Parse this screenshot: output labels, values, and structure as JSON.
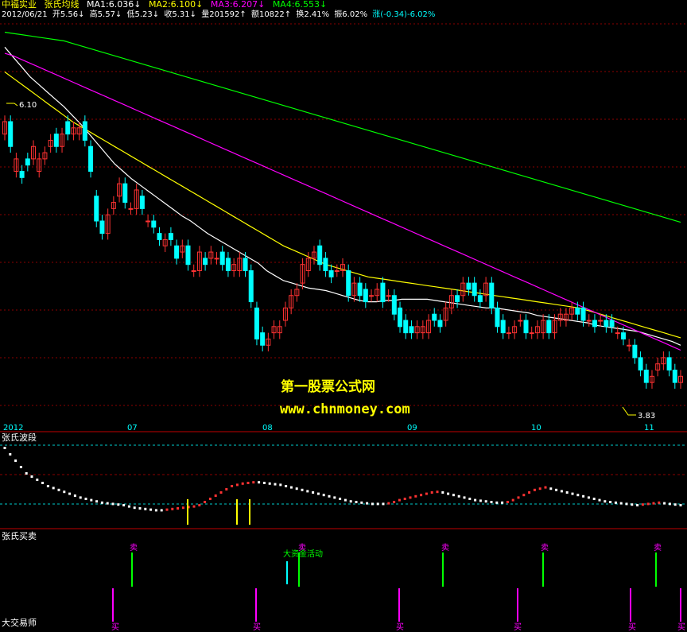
{
  "header": {
    "stock_name": "中福实业",
    "indicator_name": "张氏均线",
    "ma1": "MA1:6.036↓",
    "ma2": "MA2:6.100↓",
    "ma3": "MA3:6.207↓",
    "ma4": "MA4:6.553↓"
  },
  "info_bar": {
    "date": "2012/06/21",
    "open": "开5.56↓",
    "high": "高5.57↓",
    "low": "低5.23↓",
    "close": "收5.31↓",
    "volume": "量201592↑",
    "amount": "额10822↑",
    "turnover": "换2.41%",
    "amplitude": "振6.02%",
    "change": "涨(-0.34)-6.02%"
  },
  "price_labels": {
    "high_mark": "6.10",
    "low_mark": "3.83"
  },
  "watermark": {
    "line1": "第一股票公式网",
    "line2": "www.chnmoney.com"
  },
  "x_axis": {
    "labels": [
      "2012",
      "07",
      "08",
      "09",
      "10",
      "11"
    ]
  },
  "panel2": {
    "title": "张氏波段"
  },
  "panel3": {
    "title": "张氏买卖",
    "corner_label": "大交易师",
    "sell_label": "卖",
    "buy_label": "买",
    "big_money_label": "大资金活动"
  },
  "colors": {
    "up": "#ff3232",
    "down": "#00ffff",
    "ma1": "#ffffff",
    "ma2": "#ffff00",
    "ma3": "#ff00ff",
    "ma4": "#00ff00",
    "grid": "#8b0000",
    "sell_bar": "#00ff00",
    "buy_bar": "#ff00ff"
  },
  "chart_data": [
    {
      "type": "candlestick",
      "title": "张氏均线",
      "ylim": [
        3.6,
        6.8
      ],
      "x": [
        0,
        1,
        2,
        3,
        4,
        5,
        6,
        7,
        8,
        9,
        10,
        11,
        12,
        13,
        14,
        15,
        16,
        17,
        18,
        19,
        20,
        21,
        22,
        23,
        24,
        25,
        26,
        27,
        28,
        29,
        30,
        31,
        32,
        33,
        34,
        35,
        36,
        37,
        38,
        39,
        40,
        41,
        42,
        43,
        44,
        45,
        46,
        47,
        48,
        49,
        50,
        51,
        52,
        53,
        54,
        55,
        56,
        57,
        58,
        59,
        60,
        61,
        62,
        63,
        64,
        65,
        66,
        67,
        68,
        69,
        70,
        71,
        72,
        73,
        74,
        75,
        76,
        77,
        78,
        79,
        80,
        81,
        82,
        83,
        84,
        85,
        86,
        87,
        88,
        89,
        90,
        91,
        92,
        93,
        94,
        95,
        96,
        97,
        98,
        99,
        100,
        101,
        102,
        103,
        104,
        105,
        106,
        107,
        108,
        109,
        110,
        111,
        112,
        113,
        114,
        115,
        116,
        117,
        118,
        119,
        120,
        121,
        122,
        123,
        124,
        125,
        126,
        127,
        128,
        129,
        130,
        131,
        132,
        133,
        134,
        135,
        136,
        137,
        138,
        139
      ],
      "open": [
        5.9,
        6.0,
        5.6,
        5.6,
        5.7,
        5.7,
        5.6,
        5.7,
        5.8,
        5.9,
        5.8,
        6.0,
        5.9,
        5.9,
        6.0,
        5.8,
        5.4,
        5.2,
        5.1,
        5.3,
        5.4,
        5.5,
        5.3,
        5.3,
        5.4,
        5.2,
        5.2,
        5.1,
        5.0,
        5.1,
        5.0,
        4.95,
        5.0,
        4.8,
        4.8,
        4.9,
        4.9,
        4.9,
        4.95,
        4.9,
        4.8,
        4.8,
        4.9,
        4.8,
        4.5,
        4.3,
        4.2,
        4.3,
        4.3,
        4.4,
        4.5,
        4.6,
        4.7,
        4.8,
        4.9,
        5.0,
        4.9,
        4.8,
        4.8,
        4.8,
        4.8,
        4.6,
        4.7,
        4.65,
        4.6,
        4.6,
        4.7,
        4.6,
        4.6,
        4.5,
        4.4,
        4.35,
        4.3,
        4.3,
        4.3,
        4.45,
        4.4,
        4.4,
        4.5,
        4.6,
        4.6,
        4.7,
        4.7,
        4.6,
        4.6,
        4.7,
        4.5,
        4.4,
        4.3,
        4.3,
        4.4,
        4.4,
        4.3,
        4.3,
        4.3,
        4.4,
        4.3,
        4.4,
        4.4,
        4.45,
        4.5,
        4.5,
        4.4,
        4.4,
        4.4,
        4.4,
        4.4,
        4.3,
        4.3,
        4.2,
        4.2,
        4.1,
        4.0,
        3.9,
        4.0,
        4.05,
        4.1,
        4.0,
        3.9
      ],
      "close": [
        6.0,
        5.8,
        5.7,
        5.55,
        5.65,
        5.8,
        5.7,
        5.75,
        5.85,
        5.8,
        5.9,
        5.9,
        5.95,
        5.95,
        5.85,
        5.6,
        5.2,
        5.1,
        5.25,
        5.35,
        5.5,
        5.35,
        5.3,
        5.45,
        5.3,
        5.2,
        5.15,
        5.05,
        5.05,
        5.05,
        4.9,
        5.0,
        4.85,
        4.8,
        4.95,
        4.85,
        4.95,
        4.9,
        4.85,
        4.8,
        4.85,
        4.9,
        4.8,
        4.55,
        4.25,
        4.2,
        4.25,
        4.35,
        4.35,
        4.5,
        4.6,
        4.65,
        4.85,
        4.9,
        4.95,
        4.85,
        4.8,
        4.75,
        4.8,
        4.85,
        4.6,
        4.7,
        4.6,
        4.55,
        4.6,
        4.65,
        4.55,
        4.6,
        4.45,
        4.35,
        4.3,
        4.3,
        4.35,
        4.35,
        4.4,
        4.4,
        4.35,
        4.5,
        4.6,
        4.55,
        4.7,
        4.65,
        4.6,
        4.55,
        4.7,
        4.5,
        4.35,
        4.3,
        4.3,
        4.35,
        4.4,
        4.3,
        4.3,
        4.35,
        4.4,
        4.3,
        4.4,
        4.45,
        4.45,
        4.5,
        4.45,
        4.4,
        4.4,
        4.35,
        4.4,
        4.35,
        4.35,
        4.3,
        4.25,
        4.2,
        4.1,
        4.0,
        3.9,
        3.95,
        4.05,
        4.1,
        4.0,
        3.9,
        3.95
      ],
      "ma_series": [
        {
          "name": "MA1",
          "values": [
            6.6,
            6.52,
            6.44,
            6.36,
            6.3,
            6.24,
            6.18,
            6.12,
            6.05,
            5.98,
            5.9,
            5.82,
            5.74,
            5.66,
            5.6,
            5.54,
            5.49,
            5.44,
            5.39,
            5.34,
            5.29,
            5.24,
            5.2,
            5.15,
            5.1,
            5.06,
            5.02,
            4.98,
            4.94,
            4.9,
            4.86,
            4.8,
            4.76,
            4.72,
            4.7,
            4.68,
            4.66,
            4.65,
            4.64,
            4.62,
            4.6,
            4.58,
            4.56,
            4.55,
            4.55,
            4.56,
            4.56,
            4.57,
            4.57,
            4.57,
            4.57,
            4.56,
            4.55,
            4.54,
            4.53,
            4.52,
            4.51,
            4.5,
            4.5,
            4.49,
            4.48,
            4.47,
            4.46,
            4.44,
            4.43,
            4.42,
            4.41,
            4.4,
            4.39,
            4.38,
            4.36,
            4.35,
            4.34,
            4.33,
            4.32,
            4.31,
            4.29,
            4.27,
            4.25,
            4.23,
            4.2
          ]
        },
        {
          "name": "MA2",
          "values": [
            6.4,
            6.35,
            6.3,
            6.25,
            6.2,
            6.15,
            6.1,
            6.05,
            6.0,
            5.96,
            5.92,
            5.88,
            5.84,
            5.8,
            5.76,
            5.72,
            5.68,
            5.64,
            5.6,
            5.56,
            5.52,
            5.48,
            5.44,
            5.4,
            5.36,
            5.32,
            5.28,
            5.24,
            5.2,
            5.16,
            5.12,
            5.08,
            5.04,
            5.0,
            4.97,
            4.94,
            4.91,
            4.88,
            4.85,
            4.83,
            4.81,
            4.79,
            4.77,
            4.75,
            4.74,
            4.73,
            4.72,
            4.71,
            4.7,
            4.69,
            4.68,
            4.67,
            4.66,
            4.65,
            4.64,
            4.63,
            4.62,
            4.61,
            4.6,
            4.59,
            4.58,
            4.57,
            4.56,
            4.55,
            4.54,
            4.53,
            4.52,
            4.51,
            4.5,
            4.48,
            4.46,
            4.44,
            4.42,
            4.4,
            4.38,
            4.36,
            4.34,
            4.32,
            4.3,
            4.28,
            4.26
          ]
        },
        {
          "name": "MA3",
          "values": [
            6.55,
            6.53,
            6.5,
            6.47,
            6.44,
            6.41,
            6.38,
            6.35,
            6.32,
            6.29,
            6.26,
            6.23,
            6.2,
            6.17,
            6.14,
            6.11,
            6.08,
            6.05,
            6.02,
            5.99,
            5.96,
            5.93,
            5.9,
            5.87,
            5.84,
            5.81,
            5.78,
            5.75,
            5.72,
            5.69,
            5.66,
            5.63,
            5.6,
            5.57,
            5.54,
            5.51,
            5.48,
            5.45,
            5.42,
            5.39,
            5.36,
            5.33,
            5.3,
            5.27,
            5.24,
            5.21,
            5.18,
            5.15,
            5.12,
            5.09,
            5.06,
            5.03,
            5.0,
            4.97,
            4.94,
            4.91,
            4.88,
            4.85,
            4.82,
            4.79,
            4.76,
            4.73,
            4.7,
            4.67,
            4.64,
            4.61,
            4.58,
            4.55,
            4.52,
            4.49,
            4.46,
            4.43,
            4.4,
            4.37,
            4.34,
            4.31,
            4.28,
            4.25,
            4.22,
            4.19,
            4.16
          ]
        },
        {
          "name": "MA4",
          "values": [
            6.72,
            6.71,
            6.7,
            6.69,
            6.68,
            6.67,
            6.66,
            6.65,
            6.63,
            6.61,
            6.59,
            6.57,
            6.55,
            6.53,
            6.51,
            6.49,
            6.47,
            6.45,
            6.43,
            6.41,
            6.39,
            6.37,
            6.35,
            6.33,
            6.31,
            6.29,
            6.27,
            6.25,
            6.23,
            6.21,
            6.19,
            6.17,
            6.15,
            6.13,
            6.11,
            6.09,
            6.07,
            6.05,
            6.03,
            6.01,
            5.99,
            5.97,
            5.95,
            5.93,
            5.91,
            5.89,
            5.87,
            5.85,
            5.83,
            5.81,
            5.79,
            5.77,
            5.75,
            5.73,
            5.71,
            5.69,
            5.67,
            5.65,
            5.63,
            5.61,
            5.59,
            5.57,
            5.55,
            5.53,
            5.51,
            5.49,
            5.47,
            5.45,
            5.43,
            5.41,
            5.39,
            5.37,
            5.35,
            5.33,
            5.31,
            5.29,
            5.27,
            5.25,
            5.23,
            5.21,
            5.19
          ]
        }
      ]
    },
    {
      "type": "bar",
      "title": "张氏波段",
      "values": [
        0.9,
        0.8,
        0.7,
        0.6,
        0.5,
        0.45,
        0.4,
        0.35,
        0.3,
        0.27,
        0.24,
        0.21,
        0.18,
        0.15,
        0.12,
        0.1,
        0.08,
        0.06,
        0.04,
        0.03,
        0.02,
        0.01,
        0.0,
        -0.02,
        -0.04,
        -0.05,
        -0.06,
        -0.07,
        -0.08,
        -0.08,
        -0.07,
        -0.06,
        -0.05,
        -0.04,
        -0.03,
        -0.02,
        0.0,
        0.05,
        0.1,
        0.15,
        0.2,
        0.25,
        0.3,
        0.32,
        0.34,
        0.35,
        0.36,
        0.36,
        0.35,
        0.34,
        0.33,
        0.32,
        0.3,
        0.28,
        0.26,
        0.24,
        0.22,
        0.2,
        0.18,
        0.16,
        0.14,
        0.12,
        0.1,
        0.08,
        0.06,
        0.05,
        0.04,
        0.03,
        0.02,
        0.02,
        0.02,
        0.03,
        0.05,
        0.08,
        0.1,
        0.12,
        0.14,
        0.16,
        0.18,
        0.2,
        0.21,
        0.2,
        0.18,
        0.16,
        0.14,
        0.12,
        0.1,
        0.08,
        0.07,
        0.06,
        0.05,
        0.04,
        0.04,
        0.05,
        0.08,
        0.12,
        0.16,
        0.2,
        0.24,
        0.26,
        0.28,
        0.26,
        0.24,
        0.22,
        0.2,
        0.18,
        0.16,
        0.14,
        0.12,
        0.1,
        0.08,
        0.06,
        0.05,
        0.04,
        0.03,
        0.02,
        0.01,
        0.0,
        0.01,
        0.02,
        0.03,
        0.04,
        0.03,
        0.02,
        0.01,
        0.0
      ]
    }
  ]
}
